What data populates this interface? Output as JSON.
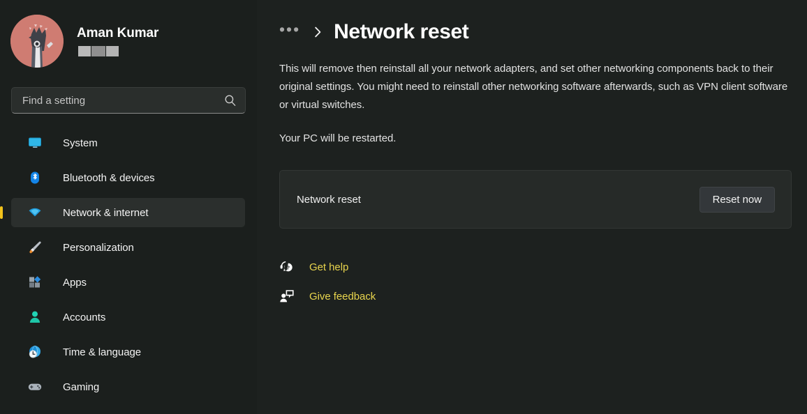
{
  "account": {
    "name": "Aman Kumar",
    "email_redacted": true,
    "avatar_icon": "user-avatar-illustration"
  },
  "search": {
    "placeholder": "Find a setting",
    "value": "",
    "icon": "search-icon"
  },
  "sidebar": {
    "items": [
      {
        "label": "System",
        "icon": "monitor-icon",
        "selected": false
      },
      {
        "label": "Bluetooth & devices",
        "icon": "bluetooth-icon",
        "selected": false
      },
      {
        "label": "Network & internet",
        "icon": "wifi-icon",
        "selected": true
      },
      {
        "label": "Personalization",
        "icon": "paintbrush-icon",
        "selected": false
      },
      {
        "label": "Apps",
        "icon": "apps-grid-icon",
        "selected": false
      },
      {
        "label": "Accounts",
        "icon": "person-icon",
        "selected": false
      },
      {
        "label": "Time & language",
        "icon": "globe-clock-icon",
        "selected": false
      },
      {
        "label": "Gaming",
        "icon": "gamepad-icon",
        "selected": false
      }
    ]
  },
  "breadcrumb": {
    "overflow_label": "•••",
    "separator_icon": "chevron-right-icon",
    "title": "Network reset"
  },
  "main": {
    "description": "This will remove then reinstall all your network adapters, and set other networking components back to their original settings. You might need to reinstall other networking software afterwards, such as VPN client software or virtual switches.",
    "restart_note": "Your PC will be restarted.",
    "card": {
      "label": "Network reset",
      "button_label": "Reset now"
    },
    "links": [
      {
        "label": "Get help",
        "icon": "help-question-icon"
      },
      {
        "label": "Give feedback",
        "icon": "feedback-person-icon"
      }
    ]
  },
  "colors": {
    "page_background": "#1d211f",
    "sidebar_background": "#1b1f1d",
    "card_background": "#262a28",
    "selection_accent": "#f2c21b",
    "link_accent": "#e8d44d",
    "avatar_background": "#cf7c72"
  }
}
